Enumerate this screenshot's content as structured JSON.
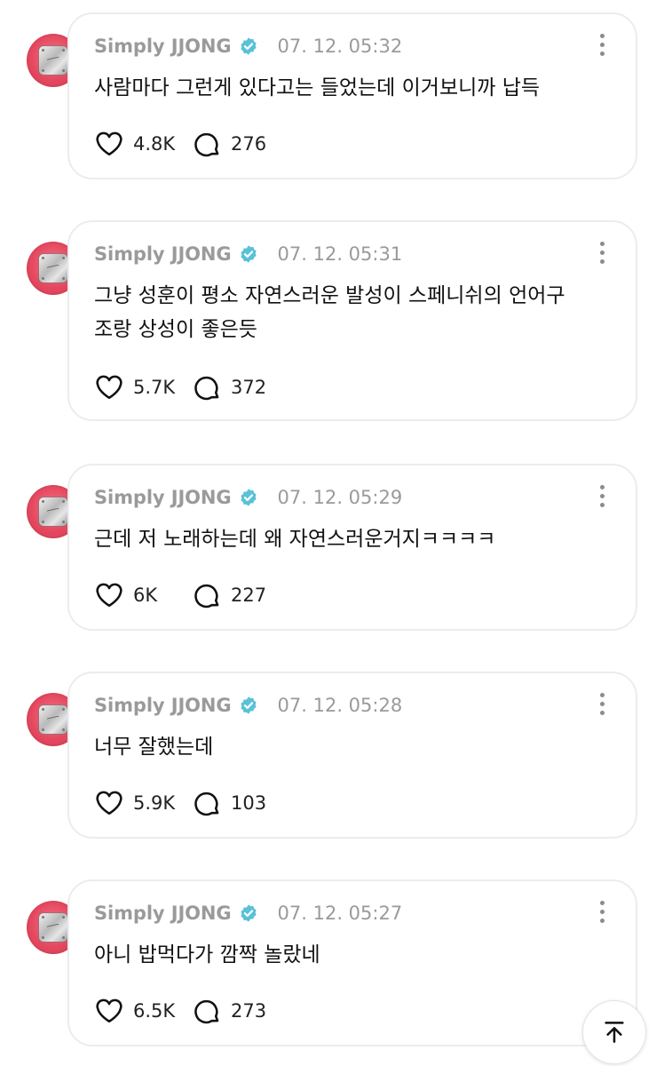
{
  "colors": {
    "verified": "#59c1d8",
    "muted": "#9a9a9a",
    "border": "#ececf0",
    "avatar": "#e5495f"
  },
  "icons": {
    "like": "heart-icon",
    "reply": "comment-bubble-icon",
    "more": "more-vertical-icon",
    "verified": "verified-badge-icon",
    "top": "arrow-up-to-top-icon"
  },
  "posts": [
    {
      "author": "Simply JJONG",
      "time": "07. 12. 05:32",
      "text": "사람마다 그런게 있다고는 들었는데 이거보니까 납득",
      "likes": "4.8K",
      "replies": "276"
    },
    {
      "author": "Simply JJONG",
      "time": "07. 12. 05:31",
      "text": "그냥 성훈이 평소 자연스러운 발성이 스페니쉬의 언어구조랑 상성이 좋은듯",
      "likes": "5.7K",
      "replies": "372"
    },
    {
      "author": "Simply JJONG",
      "time": "07. 12. 05:29",
      "text": "근데 저 노래하는데 왜 자연스러운거지ㅋㅋㅋㅋ",
      "likes": "6K",
      "replies": "227"
    },
    {
      "author": "Simply JJONG",
      "time": "07. 12. 05:28",
      "text": "너무 잘했는데",
      "likes": "5.9K",
      "replies": "103"
    },
    {
      "author": "Simply JJONG",
      "time": "07. 12. 05:27",
      "text": "아니 밥먹다가 깜짝 놀랐네",
      "likes": "6.5K",
      "replies": "273"
    }
  ]
}
